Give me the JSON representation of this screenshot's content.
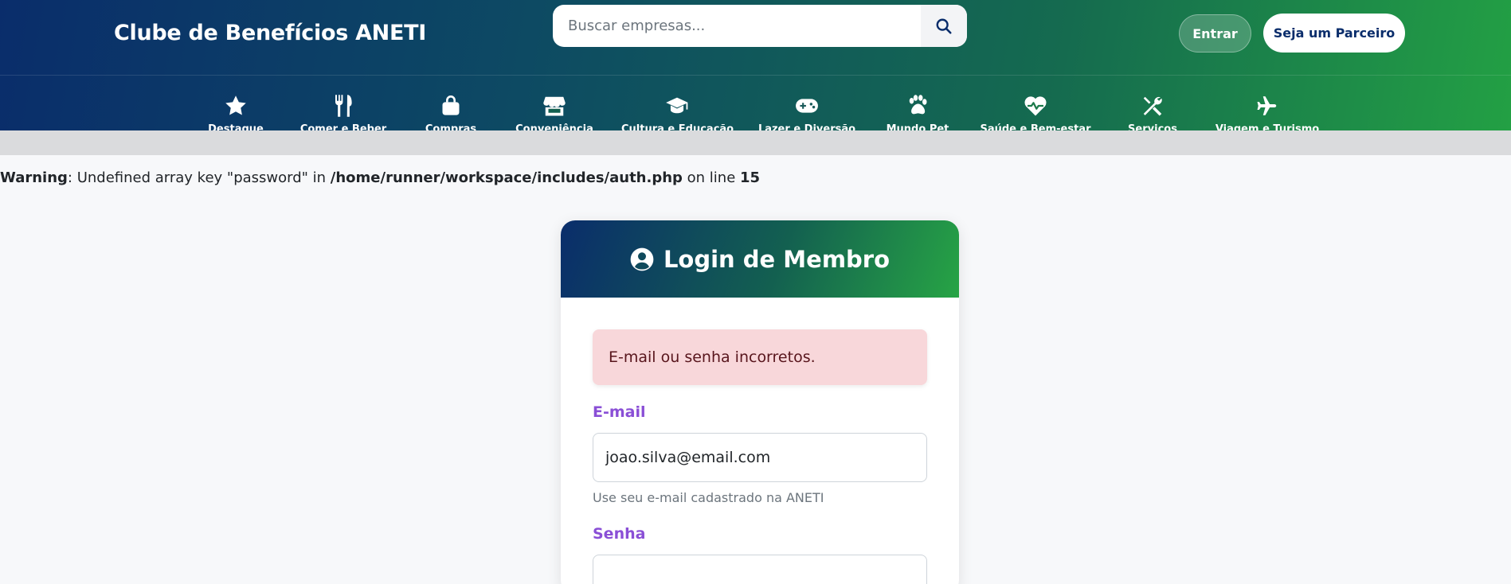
{
  "header": {
    "brand": "Clube de Benefícios ANETI",
    "search": {
      "placeholder": "Buscar empresas...",
      "value": "",
      "icon": "search-icon"
    },
    "login_button": "Entrar",
    "partner_button": "Seja um Parceiro"
  },
  "nav": {
    "items": [
      {
        "label": "Destaque",
        "icon": "star-icon"
      },
      {
        "label": "Comer e Beber",
        "icon": "utensils-icon"
      },
      {
        "label": "Compras",
        "icon": "shopping-bag-icon"
      },
      {
        "label": "Conveniência",
        "icon": "store-icon"
      },
      {
        "label": "Cultura e Educação",
        "icon": "graduation-cap-icon"
      },
      {
        "label": "Lazer e Diversão",
        "icon": "gamepad-icon"
      },
      {
        "label": "Mundo Pet",
        "icon": "paw-icon"
      },
      {
        "label": "Saúde e Bem-estar",
        "icon": "heart-pulse-icon"
      },
      {
        "label": "Serviços",
        "icon": "tools-icon"
      },
      {
        "label": "Viagem e Turismo",
        "icon": "plane-icon"
      }
    ]
  },
  "warning": {
    "prefix": "Warning",
    "message": ": Undefined array key \"password\" in ",
    "path": "/home/runner/workspace/includes/auth.php",
    "line_text": " on line ",
    "line": "15"
  },
  "login": {
    "title": "Login de Membro",
    "title_icon": "user-circle-icon",
    "error": "E-mail ou senha incorretos.",
    "email_label": "E-mail",
    "email_value": "joao.silva@email.com",
    "email_help": "Use seu e-mail cadastrado na ANETI",
    "password_label": "Senha",
    "password_value": ""
  },
  "colors": {
    "header_gradient_start": "#0a2d6b",
    "header_gradient_end": "#23a044",
    "label_purple": "#8a4fd6",
    "alert_bg": "#f8d7da",
    "alert_text": "#58151c"
  }
}
